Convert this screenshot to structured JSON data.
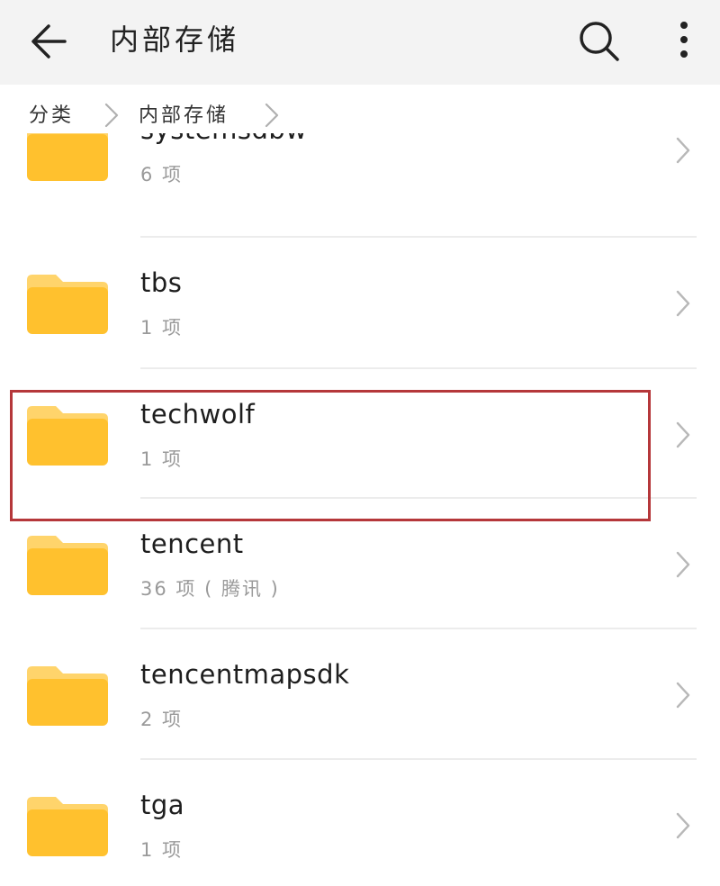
{
  "appbar": {
    "back_icon": "arrow-left-icon",
    "title": "内部存储",
    "search_icon": "search-icon",
    "more_icon": "more-vertical-icon"
  },
  "breadcrumb": {
    "items": [
      {
        "label": "分类"
      },
      {
        "label": "内部存储"
      }
    ],
    "separator_icon": "chevron-right-icon"
  },
  "folder_list": {
    "folder_icon": "folder-icon",
    "folder_color": "#FFC12E",
    "folder_tab_color": "#FFD46B",
    "items": [
      {
        "name": "systemsdbw",
        "meta": "6 项"
      },
      {
        "name": "tbs",
        "meta": "1 项"
      },
      {
        "name": "techwolf",
        "meta": "1 项"
      },
      {
        "name": "tencent",
        "meta": "36 项 ( 腾讯 )",
        "highlighted": true
      },
      {
        "name": "tencentmapsdk",
        "meta": "2 项"
      },
      {
        "name": "tga",
        "meta": "1 项"
      }
    ]
  },
  "highlight_color": "#B5373A"
}
